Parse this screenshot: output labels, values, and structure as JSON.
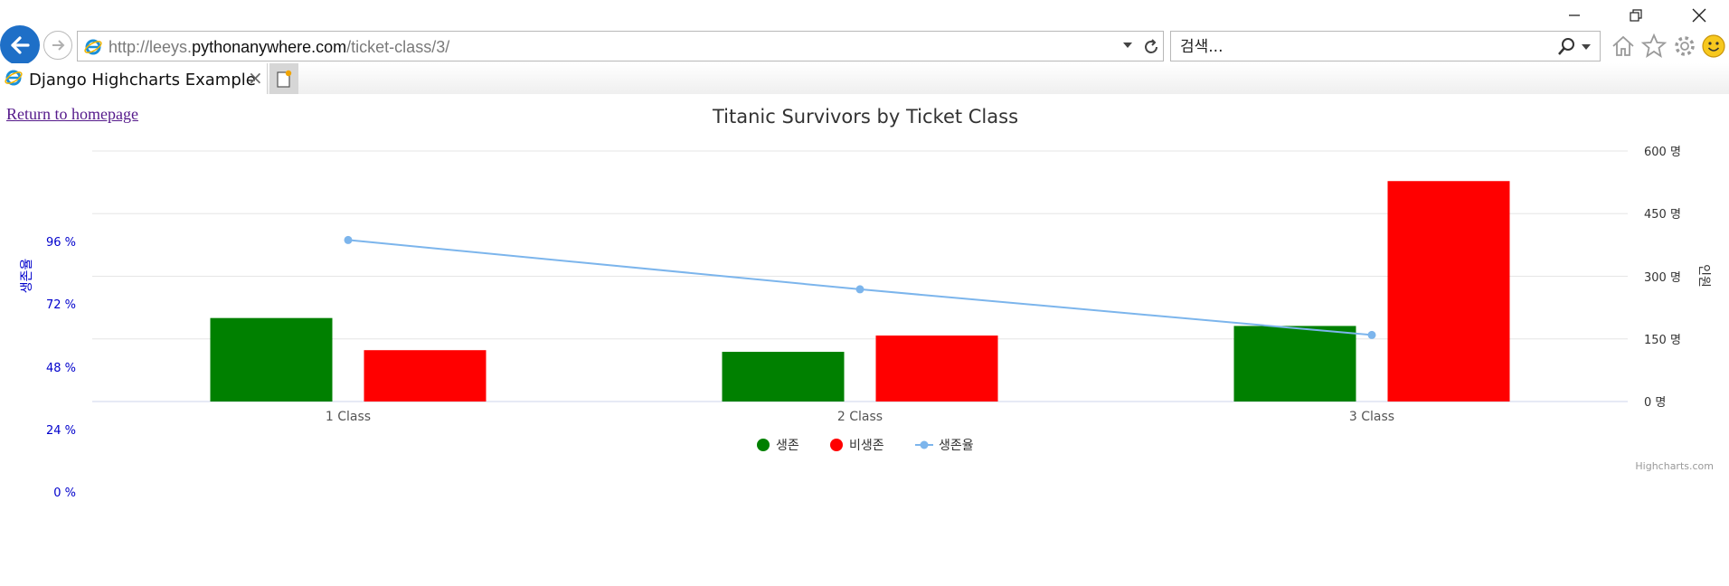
{
  "window": {
    "minimize_icon": "minimize-icon",
    "restore_icon": "restore-icon",
    "close_icon": "close-icon"
  },
  "nav": {
    "back_icon": "back-arrow-icon",
    "forward_icon": "forward-arrow-icon"
  },
  "address": {
    "url_prefix": "http://leeys.",
    "url_domain": "pythonanywhere.com",
    "url_path": "/ticket-class/3/"
  },
  "search": {
    "placeholder": "검색..."
  },
  "tab": {
    "title": "Django Highcharts Example",
    "close_label": "×"
  },
  "page": {
    "home_link": "Return to homepage",
    "credits": "Highcharts.com"
  },
  "colors": {
    "survived": "#008000",
    "not_survived": "#ff0000",
    "survival_rate": "#7cb5ec",
    "left_axis": "#0000cc",
    "browser_accent": "#1e6fc7"
  },
  "chart_data": {
    "type": "bar",
    "title": "Titanic Survivors by Ticket Class",
    "categories": [
      "1 Class",
      "2 Class",
      "3 Class"
    ],
    "series": [
      {
        "name": "생존",
        "type": "bar",
        "axis": "right",
        "color": "#008000",
        "values": [
          200,
          119,
          181
        ]
      },
      {
        "name": "비생존",
        "type": "bar",
        "axis": "right",
        "color": "#ff0000",
        "values": [
          123,
          158,
          528
        ]
      },
      {
        "name": "생존율",
        "type": "line",
        "axis": "left",
        "color": "#7cb5ec",
        "values": [
          61.9,
          43.0,
          25.5
        ]
      }
    ],
    "left_axis": {
      "label": "생존율",
      "ticks": [
        "0 %",
        "24 %",
        "48 %",
        "72 %",
        "96 %"
      ],
      "range": [
        0,
        96
      ]
    },
    "right_axis": {
      "label": "인원",
      "ticks": [
        "0 명",
        "150 명",
        "300 명",
        "450 명",
        "600 명"
      ],
      "range": [
        0,
        600
      ]
    },
    "legend": "bottom-center",
    "grid": true
  }
}
